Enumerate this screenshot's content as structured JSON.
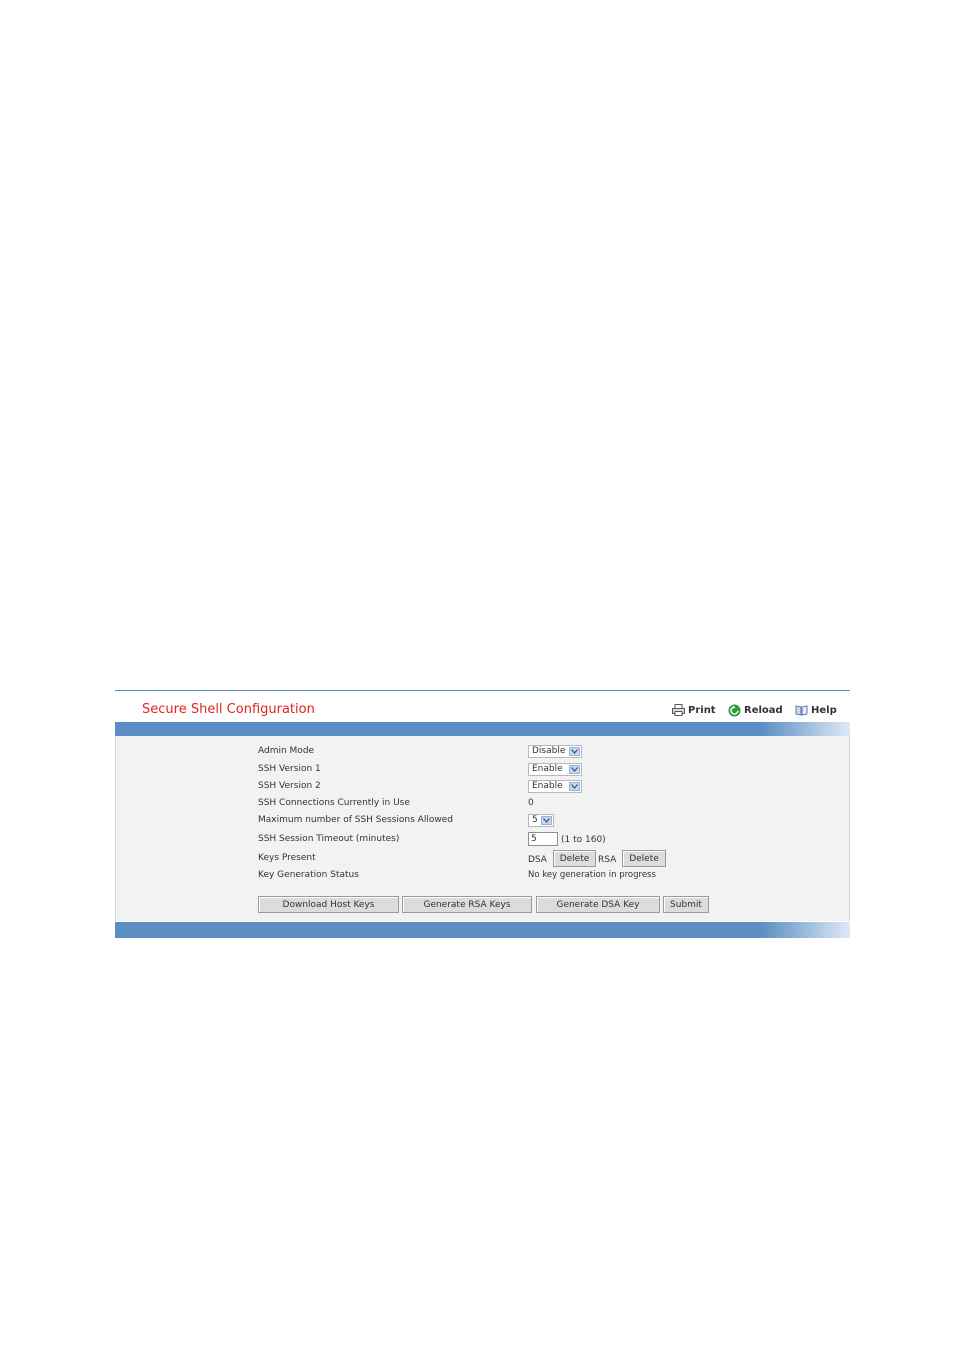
{
  "header": {
    "title": "Secure Shell Configuration",
    "print_label": "Print",
    "reload_label": "Reload",
    "help_label": "Help"
  },
  "form": {
    "admin_mode": {
      "label": "Admin Mode",
      "value": "Disable"
    },
    "ssh_v1": {
      "label": "SSH Version 1",
      "value": "Enable"
    },
    "ssh_v2": {
      "label": "SSH Version 2",
      "value": "Enable"
    },
    "connections": {
      "label": "SSH Connections Currently in Use",
      "value": "0"
    },
    "max_sessions": {
      "label": "Maximum number of SSH Sessions Allowed",
      "value": "5"
    },
    "timeout": {
      "label": "SSH Session Timeout (minutes)",
      "value": "5",
      "hint": "(1 to 160)"
    },
    "keys_present": {
      "label": "Keys Present",
      "dsa_label": "DSA",
      "rsa_label": "RSA",
      "delete_label": "Delete"
    },
    "key_gen": {
      "label": "Key Generation Status",
      "value": "No key generation in progress"
    }
  },
  "actions": {
    "download_host_keys": "Download Host Keys",
    "generate_rsa": "Generate RSA Keys",
    "generate_dsa": "Generate DSA Key",
    "submit": "Submit"
  },
  "colors": {
    "title": "#e3241b",
    "bar": "#5b8fc4",
    "panel_bg": "#f2f2f2"
  }
}
